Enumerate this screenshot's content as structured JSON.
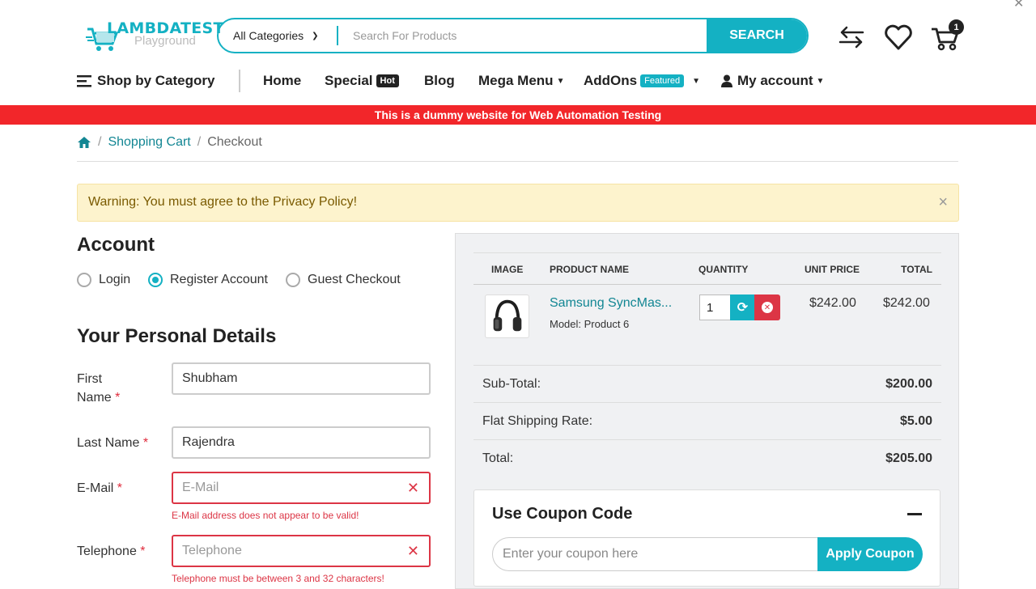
{
  "logo": {
    "line1": "LAMBDATEST",
    "line2": "Playground"
  },
  "search": {
    "category": "All Categories",
    "placeholder": "Search For Products",
    "button": "SEARCH"
  },
  "header": {
    "cart_count": "1"
  },
  "nav": {
    "shop_by_category": "Shop by Category",
    "home": "Home",
    "special": "Special",
    "special_badge": "Hot",
    "blog": "Blog",
    "mega_menu": "Mega Menu",
    "addons": "AddOns",
    "addons_badge": "Featured",
    "my_account": "My account"
  },
  "banner": "This is a dummy website for Web Automation Testing",
  "breadcrumb": {
    "cart": "Shopping Cart",
    "current": "Checkout"
  },
  "alert": "Warning: You must agree to the Privacy Policy!",
  "account": {
    "title": "Account",
    "options": [
      "Login",
      "Register Account",
      "Guest Checkout"
    ],
    "selected": "Register Account"
  },
  "personal": {
    "title": "Your Personal Details",
    "first_name_label_1": "First",
    "first_name_label_2": "Name",
    "first_name_value": "Shubham",
    "last_name_label": "Last Name",
    "last_name_value": "Rajendra",
    "email_label": "E-Mail",
    "email_placeholder": "E-Mail",
    "email_error": "E-Mail address does not appear to be valid!",
    "telephone_label": "Telephone",
    "telephone_placeholder": "Telephone",
    "telephone_error": "Telephone must be between 3 and 32 characters!"
  },
  "cart_table": {
    "headers": [
      "IMAGE",
      "PRODUCT NAME",
      "QUANTITY",
      "UNIT PRICE",
      "TOTAL"
    ],
    "product_name": "Samsung SyncMas...",
    "product_model": "Model: Product 6",
    "quantity": "1",
    "unit_price": "$242.00",
    "total": "$242.00"
  },
  "totals": [
    {
      "label": "Sub-Total:",
      "value": "$200.00"
    },
    {
      "label": "Flat Shipping Rate:",
      "value": "$5.00"
    },
    {
      "label": "Total:",
      "value": "$205.00"
    }
  ],
  "coupon": {
    "title": "Use Coupon Code",
    "placeholder": "Enter your coupon here",
    "button": "Apply Coupon"
  },
  "colors": {
    "accent": "#14b1c3",
    "banner": "#f2262a",
    "error": "#dc3545",
    "hot_badge": "#222222",
    "featured_badge": "#14b1c3"
  }
}
